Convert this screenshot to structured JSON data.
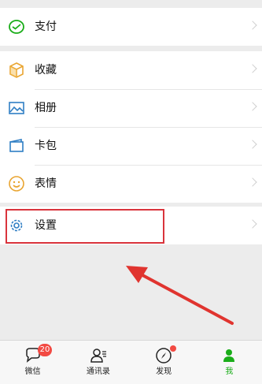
{
  "menu": {
    "pay": "支付",
    "favorites": "收藏",
    "album": "相册",
    "cards": "卡包",
    "stickers": "表情",
    "settings": "设置"
  },
  "tabbar": {
    "chats": "微信",
    "chats_badge": "20",
    "contacts": "通讯录",
    "discover": "发现",
    "me": "我"
  },
  "colors": {
    "accent_green": "#1aad19",
    "highlight_red": "#d9343c",
    "badge_red": "#f24a43"
  }
}
